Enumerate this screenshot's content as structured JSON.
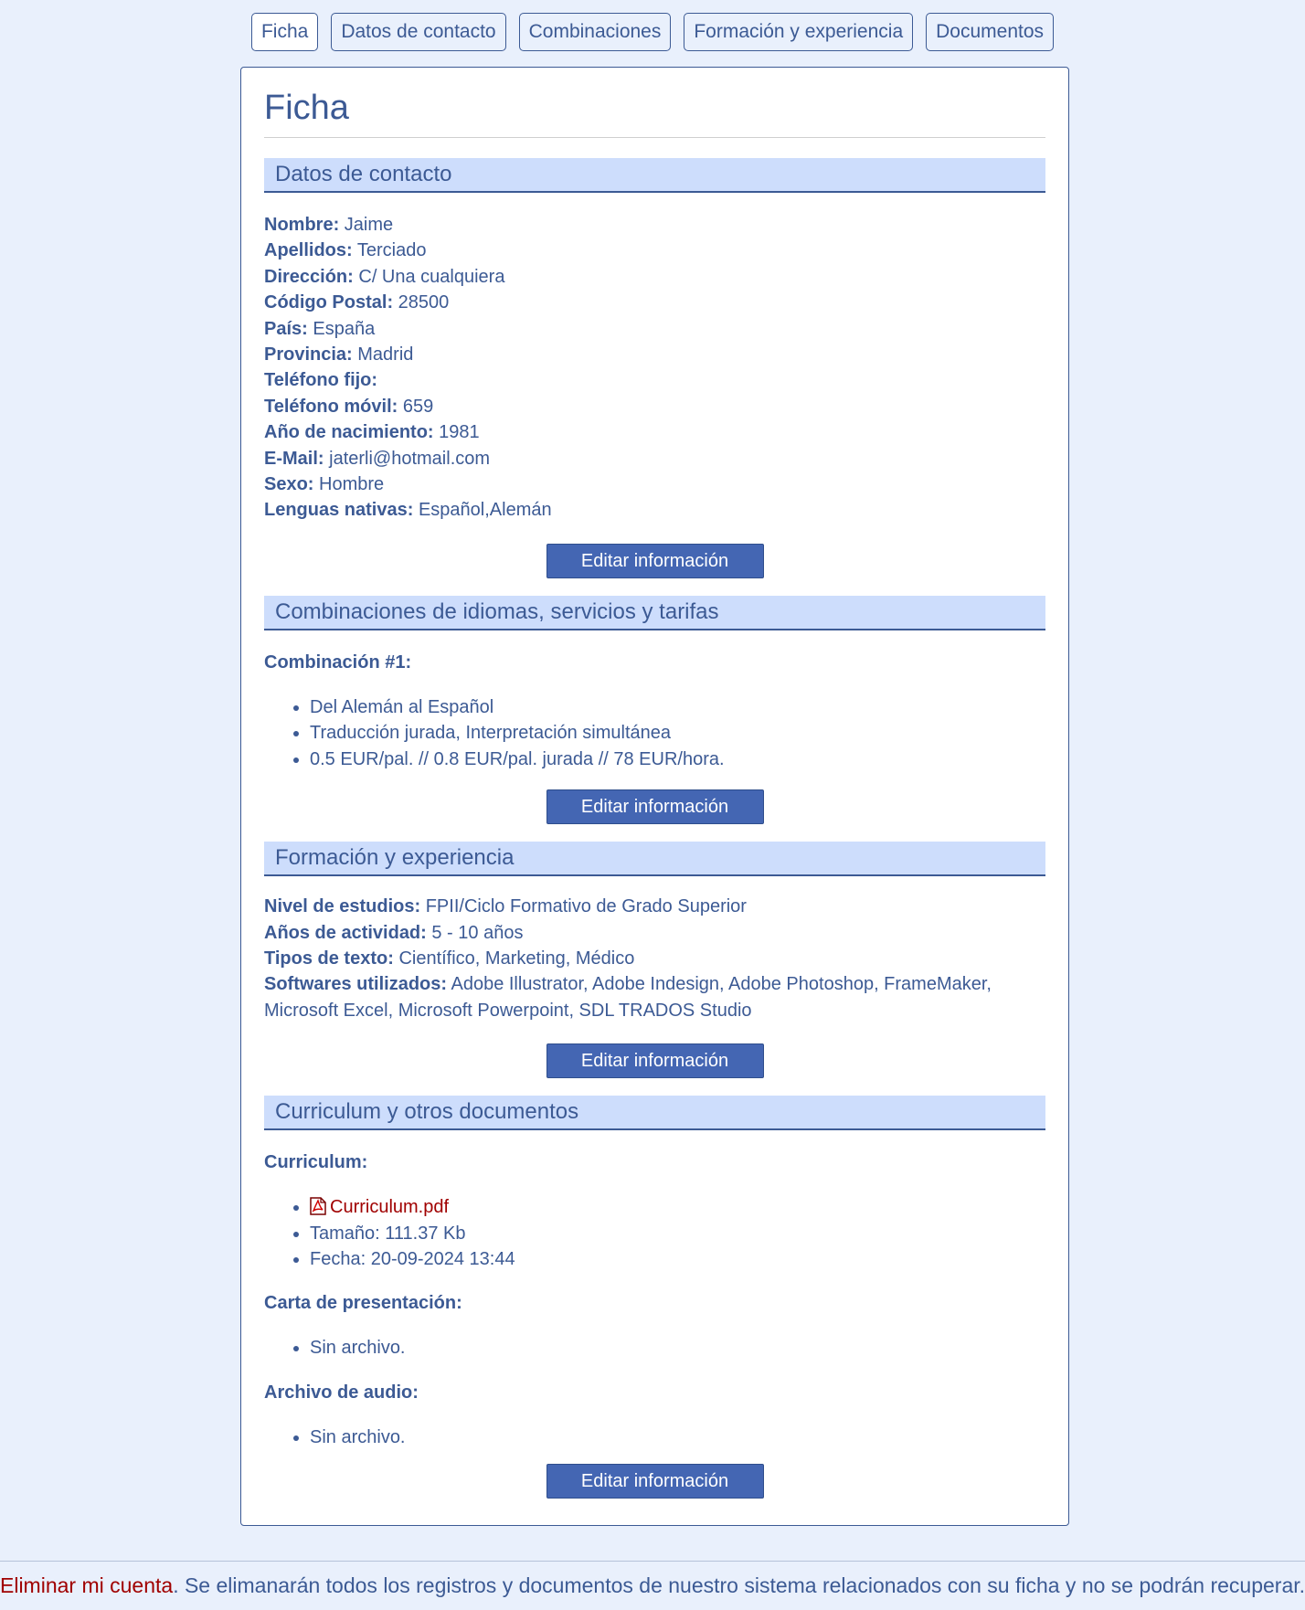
{
  "tabs": [
    "Ficha",
    "Datos de contacto",
    "Combinaciones",
    "Formación y experiencia",
    "Documentos"
  ],
  "page_title": "Ficha",
  "contact": {
    "header": "Datos de contacto",
    "fields": [
      {
        "label": "Nombre:",
        "value": "Jaime"
      },
      {
        "label": "Apellidos:",
        "value": "Terciado"
      },
      {
        "label": "Dirección:",
        "value": "C/ Una cualquiera"
      },
      {
        "label": "Código Postal:",
        "value": "28500"
      },
      {
        "label": "País:",
        "value": "España"
      },
      {
        "label": "Provincia:",
        "value": "Madrid"
      },
      {
        "label": "Teléfono fijo:",
        "value": ""
      },
      {
        "label": "Teléfono móvil:",
        "value": "659"
      },
      {
        "label": "Año de nacimiento:",
        "value": "1981"
      },
      {
        "label": "E-Mail:",
        "value": "jaterli@hotmail.com"
      },
      {
        "label": "Sexo:",
        "value": "Hombre"
      },
      {
        "label": "Lenguas nativas:",
        "value": "Español,Alemán"
      }
    ]
  },
  "edit_label": "Editar información",
  "combinations": {
    "header": "Combinaciones de idiomas, servicios y tarifas",
    "label": "Combinación #1:",
    "items": [
      "Del Alemán al Español",
      "Traducción jurada, Interpretación simultánea",
      "0.5 EUR/pal. // 0.8 EUR/pal. jurada // 78 EUR/hora."
    ]
  },
  "training": {
    "header": "Formación y experiencia",
    "fields": [
      {
        "label": "Nivel de estudios:",
        "value": "FPII/Ciclo Formativo de Grado Superior"
      },
      {
        "label": "Años de actividad:",
        "value": "5 - 10 años"
      },
      {
        "label": "Tipos de texto:",
        "value": "Científico, Marketing, Médico"
      },
      {
        "label": "Softwares utilizados:",
        "value": "Adobe Illustrator, Adobe Indesign, Adobe Photoshop, FrameMaker, Microsoft Excel, Microsoft Powerpoint, SDL TRADOS Studio"
      }
    ]
  },
  "documents": {
    "header": "Curriculum y otros documentos",
    "cv_label": "Curriculum:",
    "cv_file": "Curriculum.pdf",
    "cv_size": "Tamaño: 111.37 Kb",
    "cv_date": "Fecha: 20-09-2024 13:44",
    "cover_label": "Carta de presentación:",
    "cover_value": "Sin archivo.",
    "audio_label": "Archivo de audio:",
    "audio_value": "Sin archivo.",
    "pdf_icon": "pdf-file-icon"
  },
  "footer": {
    "delete_link": "Eliminar mi cuenta",
    "text": ". Se elimanarán todos los registros y documentos de nuestro sistema relacionados con su ficha y no se podrán recuperar."
  },
  "colors": {
    "accent": "#3c5a94",
    "button": "#4466b3",
    "section_bg": "#cdddfc",
    "link": "#a00000",
    "page_bg": "#e9f0fc"
  }
}
